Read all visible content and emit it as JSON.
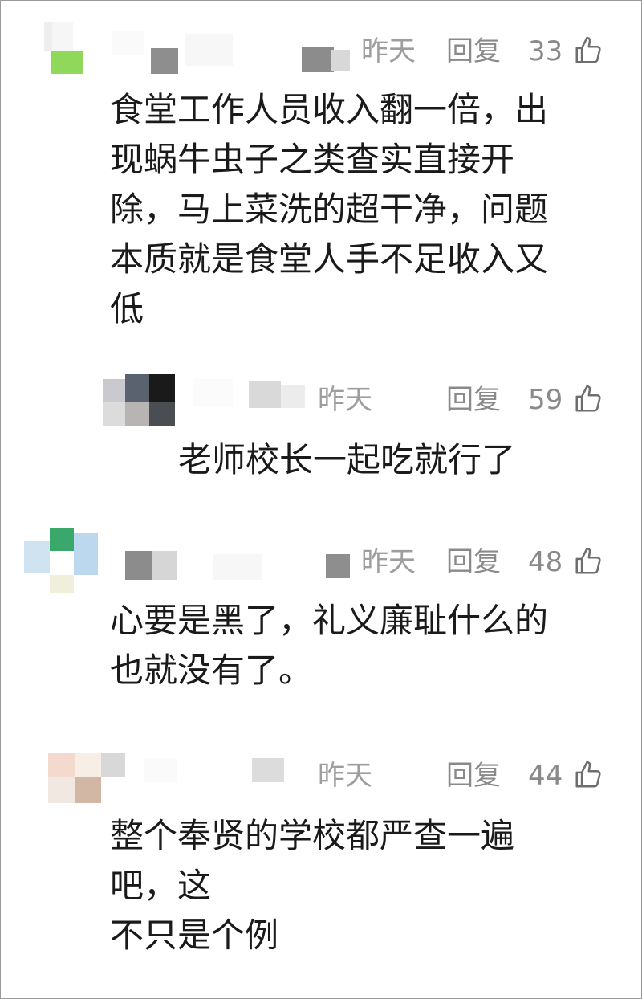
{
  "comments": [
    {
      "time": "昨天",
      "reply_label": "回复",
      "likes": "33",
      "text": "食堂工作人员收入翻一倍，出\n现蜗牛虫子之类查实直接开\n除，马上菜洗的超干净，问题\n本质就是食堂人手不足收入又\n低"
    },
    {
      "time": "昨天",
      "reply_label": "回复",
      "likes": "59",
      "text": "老师校长一起吃就行了"
    },
    {
      "time": "昨天",
      "reply_label": "回复",
      "likes": "48",
      "text": "心要是黑了，礼义廉耻什么的\n也就没有了。"
    },
    {
      "time": "昨天",
      "reply_label": "回复",
      "likes": "44",
      "text": "整个奉贤的学校都严查一遍\n吧，这\n不只是个例"
    }
  ],
  "icons": {
    "like": "thumbs-up-icon"
  },
  "colors": {
    "meta_text": "#9e9e9e",
    "body_text": "#1a1a1a"
  }
}
